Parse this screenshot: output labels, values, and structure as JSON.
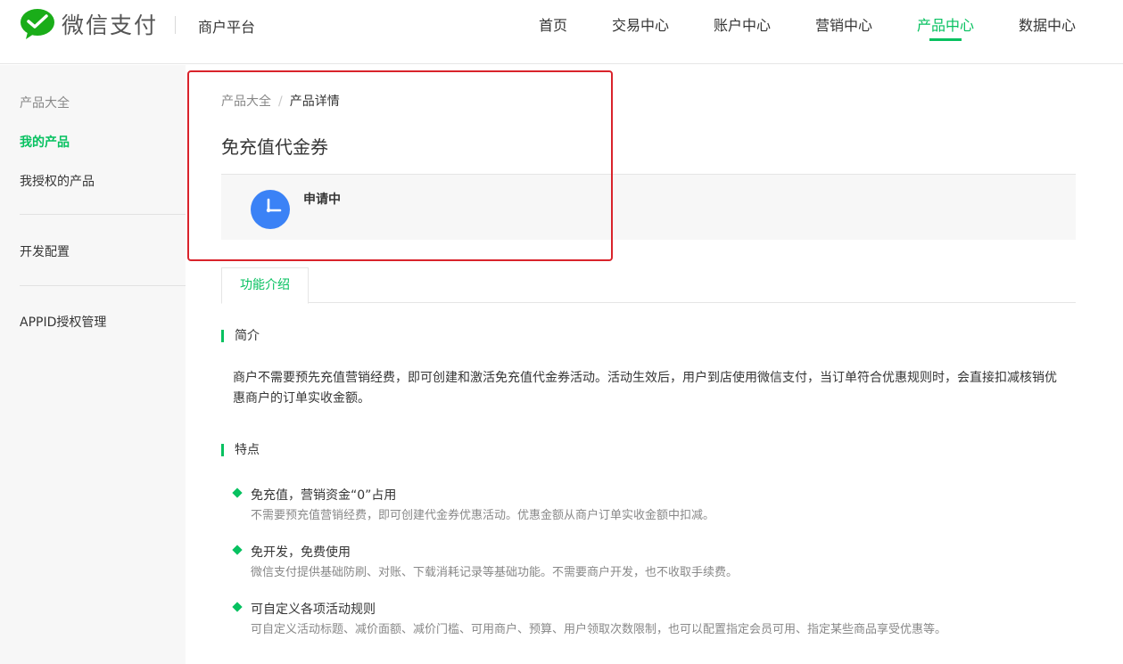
{
  "brand": {
    "name": "微信支付",
    "platform": "商户平台",
    "accent": "#07c160"
  },
  "nav": {
    "items": [
      {
        "label": "首页"
      },
      {
        "label": "交易中心"
      },
      {
        "label": "账户中心"
      },
      {
        "label": "营销中心"
      },
      {
        "label": "产品中心",
        "active": true
      },
      {
        "label": "数据中心"
      }
    ]
  },
  "sidebar": {
    "items": [
      {
        "label": "产品大全"
      },
      {
        "label": "我的产品",
        "active": true
      },
      {
        "label": "我授权的产品"
      },
      {
        "label": "开发配置"
      },
      {
        "label": "APPID授权管理"
      }
    ]
  },
  "breadcrumb": {
    "parent": "产品大全",
    "separator": "/",
    "current": "产品详情"
  },
  "product": {
    "title": "免充值代金券",
    "status": "申请中",
    "status_icon": "clock-icon",
    "status_color": "#3b82f6"
  },
  "tabs": [
    {
      "label": "功能介绍",
      "active": true
    }
  ],
  "intro": {
    "heading": "简介",
    "text": "商户不需要预先充值营销经费，即可创建和激活免充值代金券活动。活动生效后，用户到店使用微信支付，当订单符合优惠规则时，会直接扣减核销优惠商户的订单实收金额。"
  },
  "features": {
    "heading": "特点",
    "items": [
      {
        "title": "免充值，营销资金“0”占用",
        "desc": "不需要预充值营销经费，即可创建代金券优惠活动。优惠金额从商户订单实收金额中扣减。"
      },
      {
        "title": "免开发，免费使用",
        "desc": "微信支付提供基础防刷、对账、下载消耗记录等基础功能。不需要商户开发，也不收取手续费。"
      },
      {
        "title": "可自定义各项活动规则",
        "desc": "可自定义活动标题、减价面额、减价门槛、可用商户、预算、用户领取次数限制，也可以配置指定会员可用、指定某些商品享受优惠等。"
      }
    ]
  }
}
